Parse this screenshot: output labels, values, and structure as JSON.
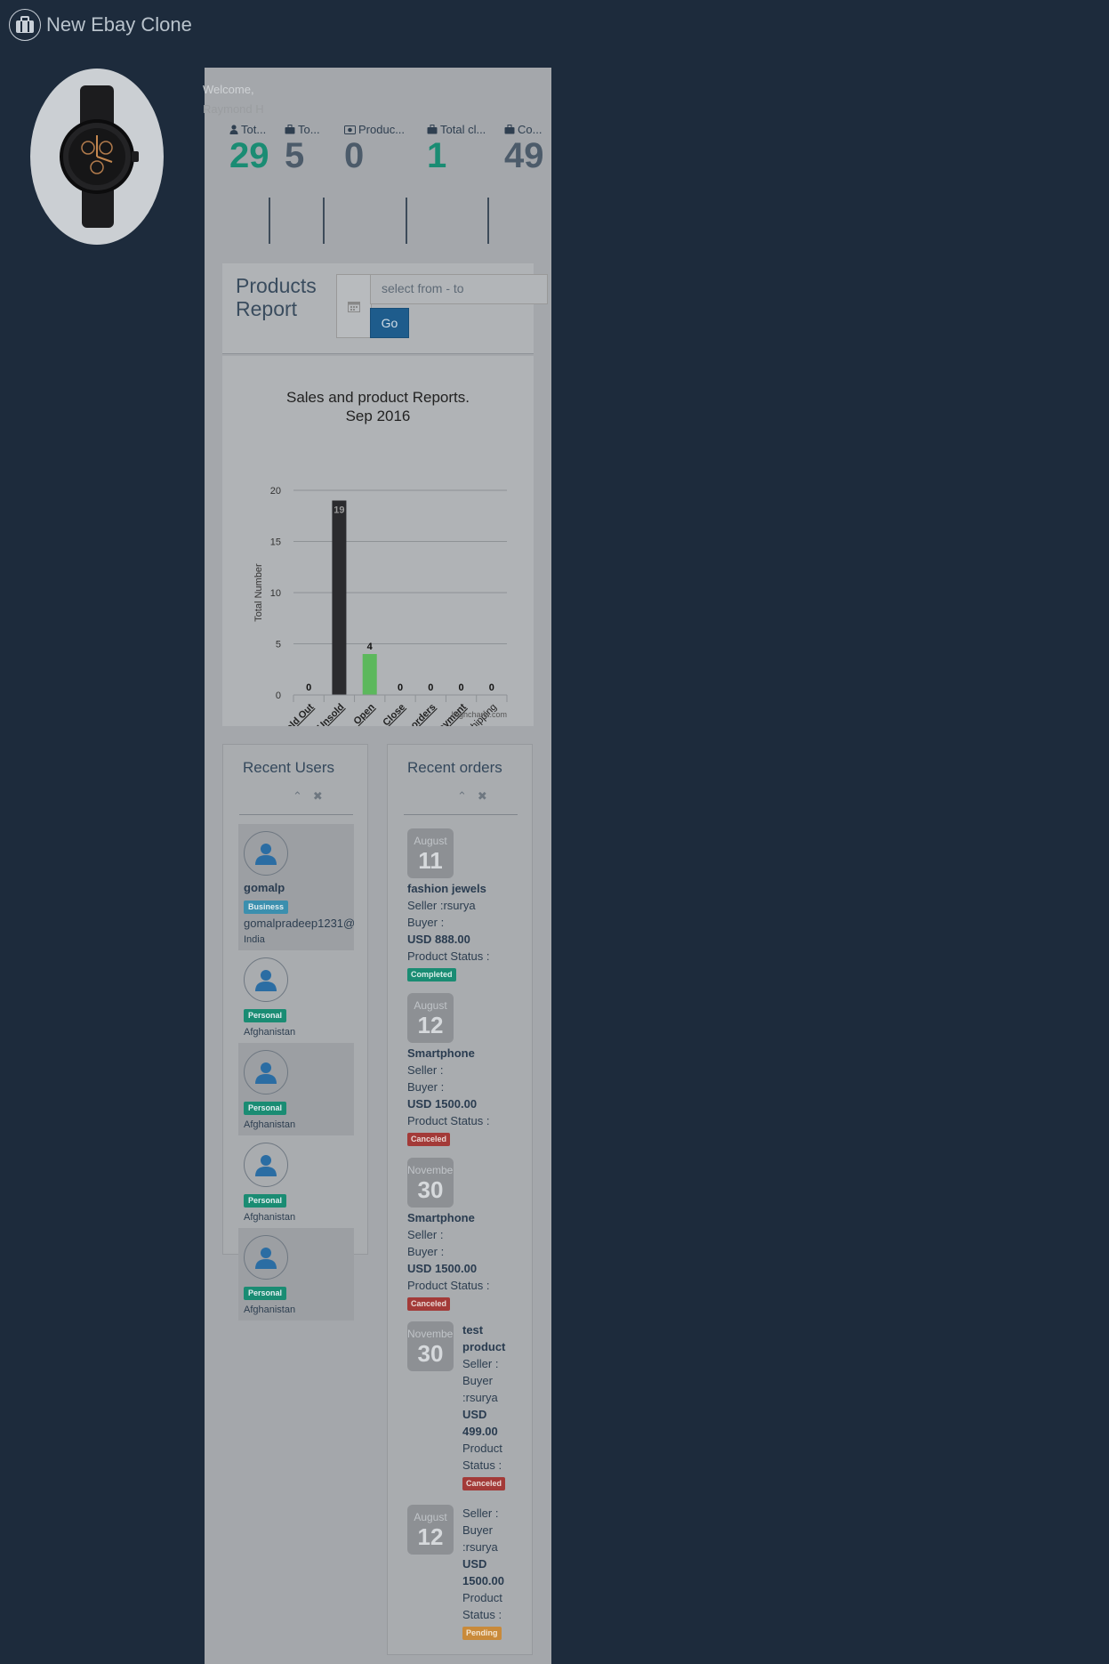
{
  "app": {
    "title": "New Ebay Clone"
  },
  "welcome": {
    "line1": "Welcome,",
    "line2": "Raymond H"
  },
  "stats": [
    {
      "label": "Tot...",
      "value": "29",
      "icon": "user-icon",
      "green": true
    },
    {
      "label": "To...",
      "value": "5",
      "icon": "briefcase-icon",
      "green": false
    },
    {
      "label": "Produc...",
      "value": "0",
      "icon": "money-icon",
      "green": false
    },
    {
      "label": "Total cl...",
      "value": "1",
      "icon": "briefcase-icon",
      "green": true
    },
    {
      "label": "Co...",
      "value": "49",
      "icon": "briefcase-icon",
      "green": false
    }
  ],
  "report": {
    "title_line1": "Products",
    "title_line2": "Report",
    "range_placeholder": "select from - to",
    "go_label": "Go"
  },
  "chart_data": {
    "type": "bar",
    "title": "Sales and product Reports.",
    "subtitle": "Sep 2016",
    "ylabel": "Total Number",
    "ylim": [
      0,
      20
    ],
    "yticks": [
      0,
      5,
      10,
      15,
      20
    ],
    "categories": [
      "Sold Out",
      "Unsold",
      "Open",
      "Close",
      "Total orders",
      "Awaiting payment",
      "On progress shipping"
    ],
    "values": [
      0,
      19,
      4,
      0,
      0,
      0,
      0
    ],
    "colors": [
      "#434348",
      "#2b2b2e",
      "#5cb85c",
      "#434348",
      "#434348",
      "#434348",
      "#434348"
    ],
    "credits": "Highcharts.com",
    "grid": true
  },
  "recent_users": {
    "title": "Recent Users",
    "users": [
      {
        "name": "gomalp",
        "type": "Business",
        "email": "gomalpradeep1231@",
        "country": "India"
      },
      {
        "name": "",
        "type": "Personal",
        "email": "",
        "country": "Afghanistan"
      },
      {
        "name": "",
        "type": "Personal",
        "email": "",
        "country": "Afghanistan"
      },
      {
        "name": "",
        "type": "Personal",
        "email": "",
        "country": "Afghanistan"
      },
      {
        "name": "",
        "type": "Personal",
        "email": "",
        "country": "Afghanistan"
      }
    ]
  },
  "recent_orders": {
    "title": "Recent orders",
    "orders": [
      {
        "month": "August",
        "day": "11",
        "product": "fashion jewels",
        "seller": "Seller :rsurya",
        "buyer": "Buyer :",
        "price": "USD 888.00",
        "status_label": "Product Status :",
        "status": "Completed"
      },
      {
        "month": "August",
        "day": "12",
        "product": "Smartphone",
        "seller": "Seller :",
        "buyer": "Buyer :",
        "price": "USD 1500.00",
        "status_label": "Product Status :",
        "status": "Canceled"
      },
      {
        "month": "November",
        "day": "30",
        "product": "Smartphone",
        "seller": "Seller :",
        "buyer": "Buyer :",
        "price": "USD 1500.00",
        "status_label": "Product Status :",
        "status": "Canceled"
      },
      {
        "month": "November",
        "day": "30",
        "product": "test product",
        "seller": "Seller :",
        "buyer": "Buyer :rsurya",
        "price": "USD 499.00",
        "status_label": "Product Status :",
        "status": "Canceled"
      },
      {
        "month": "August",
        "day": "12",
        "product": "",
        "seller": "Seller :",
        "buyer": "Buyer :rsurya",
        "price": "USD 1500.00",
        "status_label": "Product Status :",
        "status": "Pending"
      }
    ]
  }
}
